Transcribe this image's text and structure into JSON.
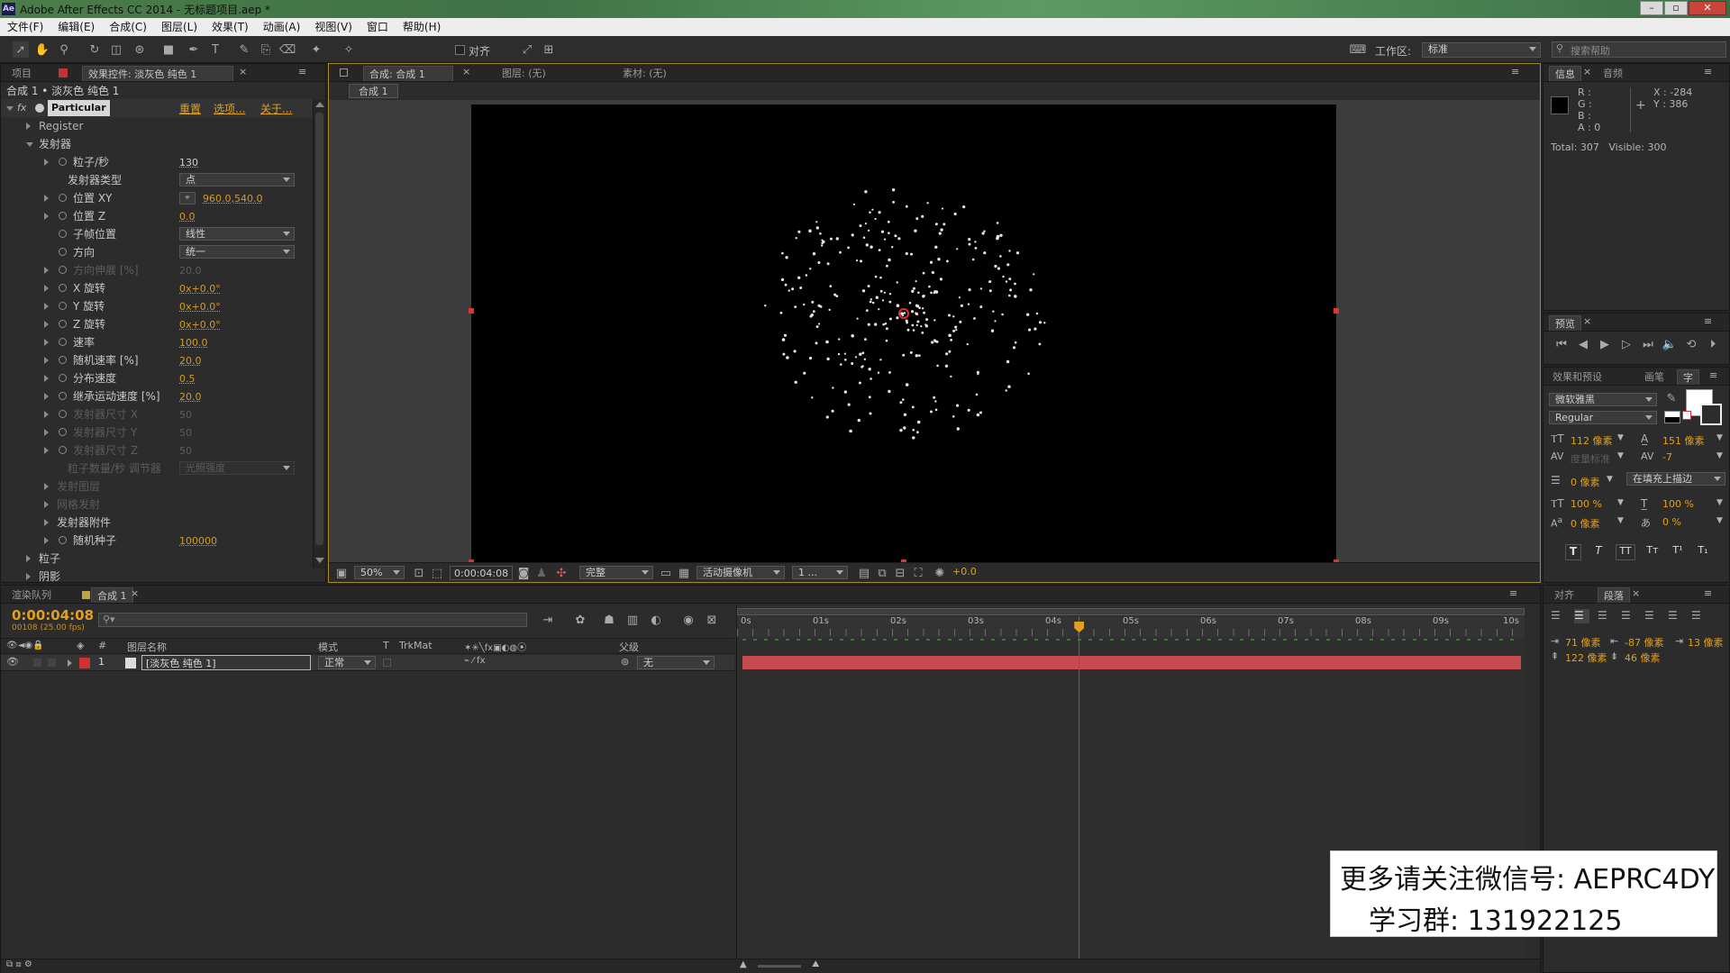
{
  "app": {
    "title": "Adobe After Effects CC 2014 - 无标题项目.aep *",
    "logo": "Ae"
  },
  "menu": [
    "文件(F)",
    "编辑(E)",
    "合成(C)",
    "图层(L)",
    "效果(T)",
    "动画(A)",
    "视图(V)",
    "窗口",
    "帮助(H)"
  ],
  "toolbar": {
    "snap_label": "对齐",
    "workspace_label": "工作区:",
    "workspace_value": "标准",
    "search_placeholder": "搜索帮助"
  },
  "left_panel": {
    "tab_project": "项目",
    "tab_effects": "效果控件: 淡灰色 纯色 1",
    "breadcrumb": "合成 1 • 淡灰色 纯色 1",
    "effect_name": "Particular",
    "links": [
      "重置",
      "选项...",
      "关于..."
    ],
    "rows": [
      {
        "label": "Register",
        "kind": "group"
      },
      {
        "label": "发射器",
        "kind": "open"
      },
      {
        "label": "粒子/秒",
        "value": "130",
        "kind": "prop"
      },
      {
        "label": "发射器类型",
        "dropdown": "点",
        "kind": "dd"
      },
      {
        "label": "位置 XY",
        "value": "960.0,540.0",
        "kind": "pos"
      },
      {
        "label": "位置 Z",
        "value": "0.0",
        "kind": "prop"
      },
      {
        "label": "子帧位置",
        "dropdown": "线性",
        "kind": "dd2"
      },
      {
        "label": "方向",
        "dropdown": "统一",
        "kind": "dd2"
      },
      {
        "label": "方向伸展 [%]",
        "value": "20.0",
        "kind": "disabled"
      },
      {
        "label": "X 旋转",
        "value": "0x+0.0°",
        "kind": "prop"
      },
      {
        "label": "Y 旋转",
        "value": "0x+0.0°",
        "kind": "prop"
      },
      {
        "label": "Z 旋转",
        "value": "0x+0.0°",
        "kind": "prop"
      },
      {
        "label": "速率",
        "value": "100.0",
        "kind": "prop"
      },
      {
        "label": "随机速率 [%]",
        "value": "20.0",
        "kind": "prop"
      },
      {
        "label": "分布速度",
        "value": "0.5",
        "kind": "prop"
      },
      {
        "label": "继承运动速度 [%]",
        "value": "20.0",
        "kind": "prop"
      },
      {
        "label": "发射器尺寸 X",
        "value": "50",
        "kind": "disabled"
      },
      {
        "label": "发射器尺寸 Y",
        "value": "50",
        "kind": "disabled"
      },
      {
        "label": "发射器尺寸 Z",
        "value": "50",
        "kind": "disabled"
      },
      {
        "label": "粒子数量/秒 调节器",
        "dropdown": "光照强度",
        "kind": "disdd"
      },
      {
        "label": "发射图层",
        "kind": "disgroup"
      },
      {
        "label": "网格发射",
        "kind": "disgroup"
      },
      {
        "label": "发射器附件",
        "kind": "group2"
      },
      {
        "label": "随机种子",
        "value": "100000",
        "kind": "prop"
      },
      {
        "label": "粒子",
        "kind": "top"
      },
      {
        "label": "阴影",
        "kind": "top"
      }
    ]
  },
  "comp_panel": {
    "tab_comp": "合成: 合成 1",
    "tab_layer": "图层: (无)",
    "tab_footage": "素材: (无)",
    "sub_tab": "合成 1",
    "zoom": "50%",
    "timecode": "0:00:04:08",
    "resolution": "完整",
    "camera": "活动摄像机",
    "views": "1 ...",
    "exposure": "+0.0"
  },
  "info_panel": {
    "tab_info": "信息",
    "tab_audio": "音频",
    "r": "R :",
    "g": "G :",
    "b": "B :",
    "a": "A : 0",
    "x": "X : -284",
    "y": "Y : 386",
    "total": "Total: 307   Visible: 300"
  },
  "preview_panel": {
    "tab": "预览"
  },
  "character_panel": {
    "tab_effects": "效果和预设",
    "tab_brush": "画笔",
    "tab_char": "字",
    "font": "微软雅黑",
    "style": "Regular",
    "size": "112 像素",
    "leading": "151 像素",
    "kerning": "度量标准",
    "tracking": "-7",
    "stroke": "0 像素",
    "stroke_mode": "在填充上描边",
    "vscale": "100 %",
    "hscale": "100 %",
    "baseline": "0 像素",
    "tsume": "0 %"
  },
  "paragraph_panel": {
    "tab_align": "对齐",
    "tab_para": "段落",
    "indent_left": "71 像素",
    "indent_first": "-87 像素",
    "indent_right": "13 像素",
    "space_before": "122 像素",
    "space_after": "46 像素"
  },
  "timeline": {
    "tab_render": "渲染队列",
    "tab_comp": "合成 1",
    "timecode": "0:00:04:08",
    "frame_info": "00108 (25.00 fps)",
    "col_num": "#",
    "col_name": "图层名称",
    "col_mode": "模式",
    "col_t": "T",
    "col_trkmat": "TrkMat",
    "col_parent": "父级",
    "layer_num": "1",
    "layer_name": "[淡灰色 纯色 1]",
    "layer_mode": "正常",
    "layer_parent": "无",
    "ruler": [
      "0s",
      "01s",
      "02s",
      "03s",
      "04s",
      "05s",
      "06s",
      "07s",
      "08s",
      "09s",
      "10s"
    ],
    "playhead_seconds": 4.32
  },
  "watermark": {
    "line1": "更多请关注微信号: AEPRC4DY",
    "line2": "学习群: 131922125"
  },
  "colors": {
    "accent": "#e0a020",
    "layer_bar": "#c8494e",
    "label_red": "#d03030",
    "playhead": "#d83030"
  }
}
